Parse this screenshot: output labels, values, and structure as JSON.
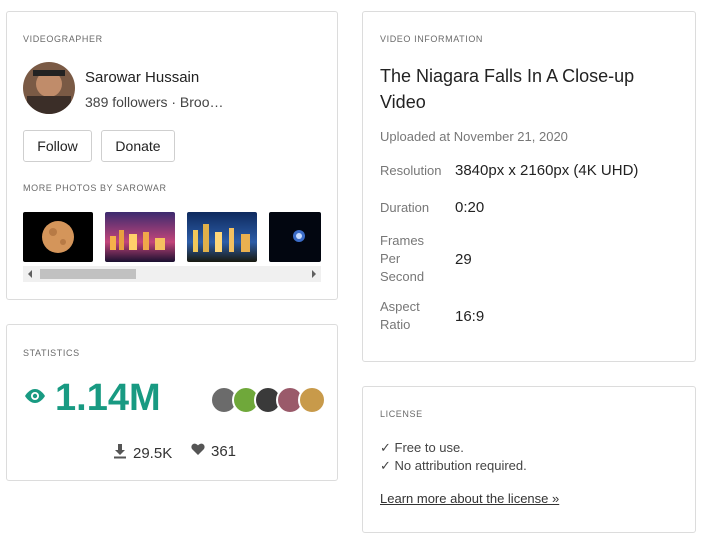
{
  "videographer": {
    "section_label": "VIDEOGRAPHER",
    "name": "Sarowar Hussain",
    "subtitle": "389 followers · Broo…",
    "follow_label": "Follow",
    "donate_label": "Donate",
    "more_label": "MORE PHOTOS BY SAROWAR",
    "thumbnails": [
      "moon",
      "city-night-1",
      "city-night-2",
      "night-sky"
    ]
  },
  "statistics": {
    "section_label": "STATISTICS",
    "views": "1.14M",
    "downloads": "29.5K",
    "likes": "361",
    "accent_color": "#189a82"
  },
  "video_info": {
    "section_label": "VIDEO INFORMATION",
    "title": "The Niagara Falls In A Close-up Video",
    "uploaded": "Uploaded at November 21, 2020",
    "rows": [
      {
        "key": "Resolution",
        "value": "3840px x 2160px (4K UHD)"
      },
      {
        "key": "Duration",
        "value": "0:20"
      },
      {
        "key_lines": [
          "Frames",
          "Per",
          "Second"
        ],
        "value": "29"
      },
      {
        "key_lines": [
          "Aspect",
          "Ratio"
        ],
        "value": "16:9"
      }
    ]
  },
  "license": {
    "section_label": "LICENSE",
    "line1": "✓ Free to use.",
    "line2": "✓ No attribution required.",
    "link": "Learn more about the license »"
  }
}
